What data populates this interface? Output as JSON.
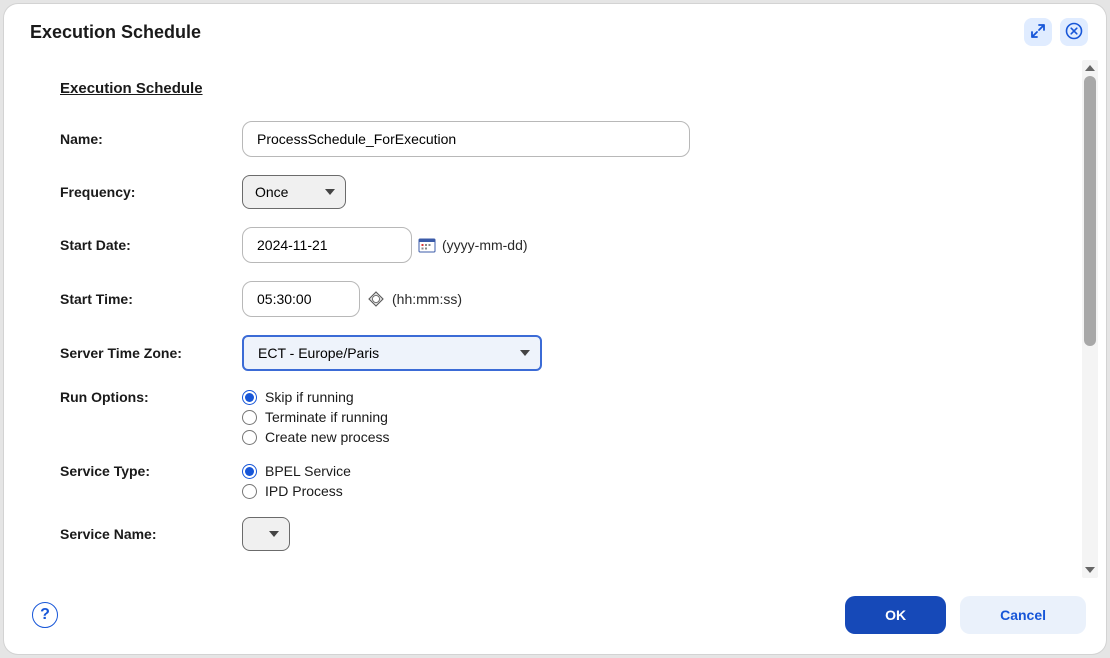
{
  "dialog": {
    "title": "Execution Schedule"
  },
  "section": {
    "title": "Execution Schedule"
  },
  "form": {
    "name": {
      "label": "Name:",
      "value": "ProcessSchedule_ForExecution"
    },
    "frequency": {
      "label": "Frequency:",
      "value": "Once"
    },
    "startDate": {
      "label": "Start Date:",
      "value": "2024-11-21",
      "hint": "(yyyy-mm-dd)"
    },
    "startTime": {
      "label": "Start Time:",
      "value": "05:30:00",
      "hint": "(hh:mm:ss)"
    },
    "timezone": {
      "label": "Server Time Zone:",
      "value": "ECT - Europe/Paris"
    },
    "runOptions": {
      "label": "Run Options:",
      "options": {
        "skip": "Skip if running",
        "terminate": "Terminate if running",
        "create": "Create new process"
      },
      "selected": "skip"
    },
    "serviceType": {
      "label": "Service Type:",
      "options": {
        "bpel": "BPEL Service",
        "ipd": "IPD Process"
      },
      "selected": "bpel"
    },
    "serviceName": {
      "label": "Service Name:",
      "value": ""
    }
  },
  "footer": {
    "ok": "OK",
    "cancel": "Cancel",
    "help": "?"
  }
}
